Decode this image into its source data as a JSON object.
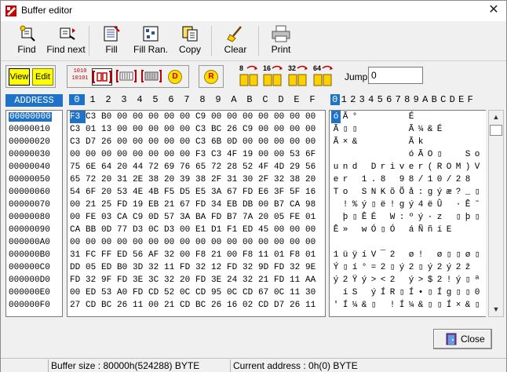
{
  "window": {
    "title": "Buffer editor",
    "close_glyph": "✕"
  },
  "toolbar": {
    "find": "Find",
    "find_next": "Find next",
    "fill": "Fill",
    "fill_ran": "Fill Ran.",
    "copy": "Copy",
    "clear": "Clear",
    "print": "Print"
  },
  "modes": {
    "view": "View",
    "edit": "Edit"
  },
  "toolbar2": {
    "fill_bits_icon": "1010\n10101",
    "d_label": "D",
    "r_label": "R",
    "bit_buttons": [
      "8",
      "16",
      "32",
      "64"
    ],
    "jump_label": "Jump",
    "jump_value": "0"
  },
  "grid": {
    "address_header": "ADDRESS",
    "columns": [
      "0",
      "1",
      "2",
      "3",
      "4",
      "5",
      "6",
      "7",
      "8",
      "9",
      "A",
      "B",
      "C",
      "D",
      "E",
      "F"
    ],
    "ascii_columns": [
      "0",
      "1",
      "2",
      "3",
      "4",
      "5",
      "6",
      "7",
      "8",
      "9",
      "A",
      "B",
      "C",
      "D",
      "E",
      "F"
    ],
    "rows": [
      {
        "addr": "00000000",
        "hex": [
          "F3",
          "C3",
          "B0",
          "00",
          "00",
          "00",
          "00",
          "00",
          "C9",
          "00",
          "00",
          "00",
          "00",
          "00",
          "00",
          "00"
        ],
        "ascii": "óÃ°     É       "
      },
      {
        "addr": "00000010",
        "hex": [
          "C3",
          "01",
          "13",
          "00",
          "00",
          "00",
          "00",
          "00",
          "C3",
          "BC",
          "26",
          "C9",
          "00",
          "00",
          "00",
          "00"
        ],
        "ascii": "Ã▯▯     Ã¼&É    "
      },
      {
        "addr": "00000020",
        "hex": [
          "C3",
          "D7",
          "26",
          "00",
          "00",
          "00",
          "00",
          "00",
          "C3",
          "6B",
          "0D",
          "00",
          "00",
          "00",
          "00",
          "00"
        ],
        "ascii": "Ã×&     Ãk      "
      },
      {
        "addr": "00000030",
        "hex": [
          "00",
          "00",
          "00",
          "00",
          "00",
          "00",
          "00",
          "00",
          "F3",
          "C3",
          "4F",
          "19",
          "00",
          "00",
          "53",
          "6F"
        ],
        "ascii": "        óÃO▯  So"
      },
      {
        "addr": "00000040",
        "hex": [
          "75",
          "6E",
          "64",
          "20",
          "44",
          "72",
          "69",
          "76",
          "65",
          "72",
          "28",
          "52",
          "4F",
          "4D",
          "29",
          "56"
        ],
        "ascii": "und Driver(ROM)V"
      },
      {
        "addr": "00000050",
        "hex": [
          "65",
          "72",
          "20",
          "31",
          "2E",
          "38",
          "20",
          "39",
          "38",
          "2F",
          "31",
          "30",
          "2F",
          "32",
          "38",
          "20"
        ],
        "ascii": "er 1.8 98/10/28 "
      },
      {
        "addr": "00000060",
        "hex": [
          "54",
          "6F",
          "20",
          "53",
          "4E",
          "4B",
          "F5",
          "D5",
          "E5",
          "3A",
          "67",
          "FD",
          "E6",
          "3F",
          "5F",
          "16"
        ],
        "ascii": "To SNKõÕå:gýæ?_▯"
      },
      {
        "addr": "00000070",
        "hex": [
          "00",
          "21",
          "25",
          "FD",
          "19",
          "EB",
          "21",
          "67",
          "FD",
          "34",
          "EB",
          "DB",
          "00",
          "B7",
          "CA",
          "98"
        ],
        "ascii": " !%ý▯ë!gý4ëÛ ·Ê˜"
      },
      {
        "addr": "00000080",
        "hex": [
          "00",
          "FE",
          "03",
          "CA",
          "C9",
          "0D",
          "57",
          "3A",
          "BA",
          "FD",
          "B7",
          "7A",
          "20",
          "05",
          "FE",
          "01"
        ],
        "ascii": " þ▯ÊÉ W:ºý·z ▯þ▯"
      },
      {
        "addr": "00000090",
        "hex": [
          "CA",
          "BB",
          "0D",
          "77",
          "D3",
          "0C",
          "D3",
          "00",
          "E1",
          "D1",
          "F1",
          "ED",
          "45",
          "00",
          "00",
          "00"
        ],
        "ascii": "Ê» wÓ▯Ó áÑñíE   "
      },
      {
        "addr": "000000A0",
        "hex": [
          "00",
          "00",
          "00",
          "00",
          "00",
          "00",
          "00",
          "00",
          "00",
          "00",
          "00",
          "00",
          "00",
          "00",
          "00",
          "00"
        ],
        "ascii": "                "
      },
      {
        "addr": "000000B0",
        "hex": [
          "31",
          "FC",
          "FF",
          "ED",
          "56",
          "AF",
          "32",
          "00",
          "F8",
          "21",
          "00",
          "F8",
          "11",
          "01",
          "F8",
          "01"
        ],
        "ascii": "1üÿíV¯2 ø! ø▯▯ø▯"
      },
      {
        "addr": "000000C0",
        "hex": [
          "DD",
          "05",
          "ED",
          "B0",
          "3D",
          "32",
          "11",
          "FD",
          "32",
          "12",
          "FD",
          "32",
          "9D",
          "FD",
          "32",
          "9E"
        ],
        "ascii": "Ý▯í°=2▯ý2▯ý2ý2ž"
      },
      {
        "addr": "000000D0",
        "hex": [
          "FD",
          "32",
          "9F",
          "FD",
          "3E",
          "3C",
          "32",
          "20",
          "FD",
          "3E",
          "24",
          "32",
          "21",
          "FD",
          "11",
          "AA"
        ],
        "ascii": "ý2Ÿý><2 ý>$2!ý▯ª"
      },
      {
        "addr": "000000E0",
        "hex": [
          "00",
          "ED",
          "53",
          "A0",
          "FD",
          "CD",
          "52",
          "0C",
          "CD",
          "95",
          "0C",
          "CD",
          "67",
          "0C",
          "11",
          "30"
        ],
        "ascii": " íS ýÍR▯Í•▯Íg▯▯0"
      },
      {
        "addr": "000000F0",
        "hex": [
          "27",
          "CD",
          "BC",
          "26",
          "11",
          "00",
          "21",
          "CD",
          "BC",
          "26",
          "16",
          "02",
          "CD",
          "D7",
          "26",
          "11"
        ],
        "ascii": "'Í¼&▯ !Í¼&▯▯Í×&▯"
      }
    ]
  },
  "close_button": "Close",
  "status": {
    "buffer_size": "Buffer size : 80000h(524288) BYTE",
    "current_address": "Current address : 0h(0) BYTE"
  }
}
